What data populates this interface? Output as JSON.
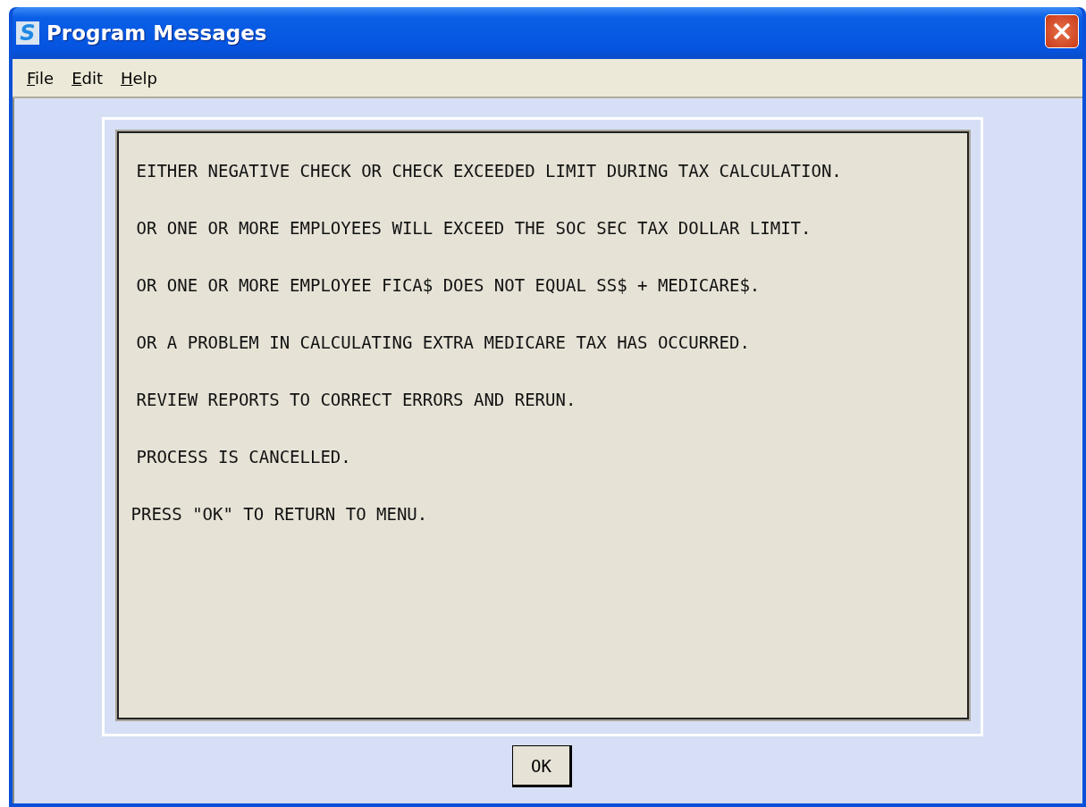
{
  "window": {
    "title": "Program Messages",
    "app_letter": "S"
  },
  "menu": [
    {
      "label": "File"
    },
    {
      "label": "Edit"
    },
    {
      "label": "Help"
    }
  ],
  "messages": [
    "EITHER NEGATIVE CHECK OR CHECK EXCEEDED LIMIT DURING TAX CALCULATION.",
    "OR ONE OR MORE EMPLOYEES WILL EXCEED THE SOC SEC TAX DOLLAR LIMIT.",
    "OR ONE OR MORE EMPLOYEE FICA$ DOES NOT EQUAL SS$ + MEDICARE$.",
    "OR A PROBLEM IN CALCULATING EXTRA MEDICARE TAX HAS OCCURRED.",
    "REVIEW REPORTS TO CORRECT ERRORS AND RERUN.",
    "PROCESS IS CANCELLED.",
    "PRESS \"OK\" TO RETURN TO MENU."
  ],
  "buttons": [
    "OK"
  ]
}
